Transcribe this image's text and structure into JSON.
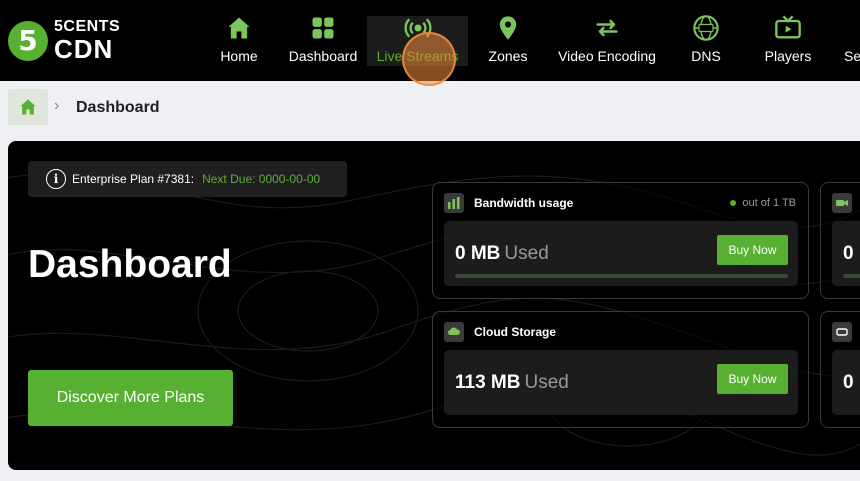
{
  "brand": {
    "badge": "5",
    "line1": "5CENTS",
    "line2": "CDN"
  },
  "nav": [
    {
      "label": "Home",
      "icon": "home-icon"
    },
    {
      "label": "Dashboard",
      "icon": "dashboard-grid-icon"
    },
    {
      "label": "Live Streams",
      "icon": "live-broadcast-icon",
      "active": true
    },
    {
      "label": "Zones",
      "icon": "location-pin-icon"
    },
    {
      "label": "Video Encoding",
      "icon": "encoding-arrows-icon"
    },
    {
      "label": "DNS",
      "icon": "dns-globe-icon"
    },
    {
      "label": "Players",
      "icon": "tv-player-icon"
    },
    {
      "label": "Se",
      "icon": "settings-icon"
    }
  ],
  "breadcrumb": {
    "current": "Dashboard"
  },
  "plan": {
    "label": "Enterprise Plan #7381:",
    "due": "Next Due: 0000-00-00"
  },
  "page_title": "Dashboard",
  "discover_label": "Discover More Plans",
  "cards": [
    {
      "title": "Bandwidth usage",
      "limit": "out of 1 TB",
      "amount": "0 MB",
      "used_label": "Used",
      "button": "Buy Now",
      "progress": 0.0
    },
    {
      "title": "Cloud Storage",
      "amount": "113 MB",
      "used_label": "Used",
      "button": "Buy Now"
    }
  ],
  "partial_cards": [
    {
      "value": "0"
    },
    {
      "value": "0"
    }
  ],
  "colors": {
    "accent": "#58b032",
    "nav_bg": "#000000",
    "page_bg": "#eef0f3"
  }
}
